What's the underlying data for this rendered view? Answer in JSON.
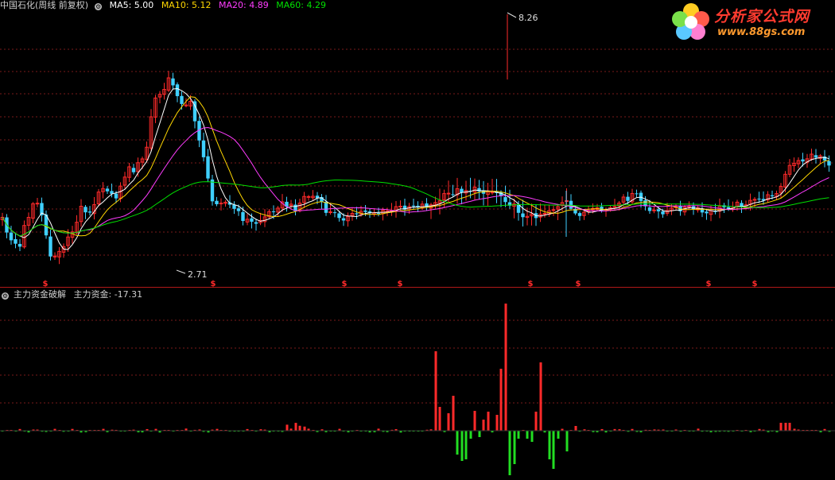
{
  "header": {
    "stock_title": "中国石化(周线 前复权)",
    "ma_items": [
      {
        "text": "MA5: 5.00",
        "color": "#ffffff"
      },
      {
        "text": "MA10: 5.12",
        "color": "#ffd700"
      },
      {
        "text": "MA20: 4.89",
        "color": "#ff3cff"
      },
      {
        "text": "MA60: 4.29",
        "color": "#00e000"
      }
    ]
  },
  "indicator_header": {
    "name": "主力资金破解",
    "value_text": "主力资金: -17.31"
  },
  "logo": {
    "brand": "分析家公式网",
    "url": "www.88gs.com"
  },
  "colors": {
    "up": "#ff2a2a",
    "down": "#3fd0ff",
    "flow_up": "#ff2a2a",
    "flow_down": "#22dd22",
    "grid": "#7a1a1a",
    "title": "#cfcfcf"
  },
  "chart_data": {
    "type": "candlestick_with_histogram",
    "price_panel": {
      "high_annotation": "8.26",
      "low_annotation": "2.71",
      "signal_marker": "$",
      "signal_marker_color": "#ff2a2a"
    },
    "indicator_panel": {
      "name": "主力资金破解",
      "series": "主力资金",
      "last_value": -17.31
    }
  }
}
